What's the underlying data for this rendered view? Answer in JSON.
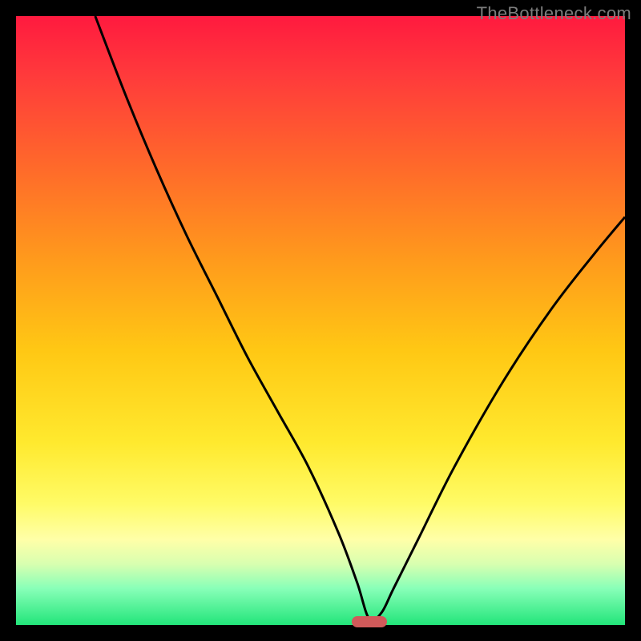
{
  "watermark": "TheBottleneck.com",
  "chart_data": {
    "type": "line",
    "title": "",
    "xlabel": "",
    "ylabel": "",
    "xlim": [
      0,
      100
    ],
    "ylim": [
      0,
      100
    ],
    "grid": false,
    "legend": false,
    "marker": {
      "x": 58,
      "y": 0,
      "width": 6
    },
    "series": [
      {
        "name": "curve",
        "x": [
          13,
          18,
          23,
          28,
          33,
          38,
          43,
          48,
          53,
          56,
          58,
          60,
          62,
          66,
          72,
          80,
          88,
          95,
          100
        ],
        "y": [
          100,
          87,
          75,
          64,
          54,
          44,
          35,
          26,
          15,
          7,
          1,
          2,
          6,
          14,
          26,
          40,
          52,
          61,
          67
        ]
      }
    ],
    "background_gradient": {
      "stops": [
        {
          "pos": 0,
          "color": "#ff1a3f"
        },
        {
          "pos": 10,
          "color": "#ff3b3b"
        },
        {
          "pos": 25,
          "color": "#ff6a2a"
        },
        {
          "pos": 40,
          "color": "#ff9a1c"
        },
        {
          "pos": 55,
          "color": "#ffc814"
        },
        {
          "pos": 70,
          "color": "#ffe92e"
        },
        {
          "pos": 80,
          "color": "#fffb66"
        },
        {
          "pos": 86,
          "color": "#ffffa8"
        },
        {
          "pos": 90,
          "color": "#d8ffb0"
        },
        {
          "pos": 94,
          "color": "#88ffb8"
        },
        {
          "pos": 100,
          "color": "#22e57a"
        }
      ]
    }
  }
}
